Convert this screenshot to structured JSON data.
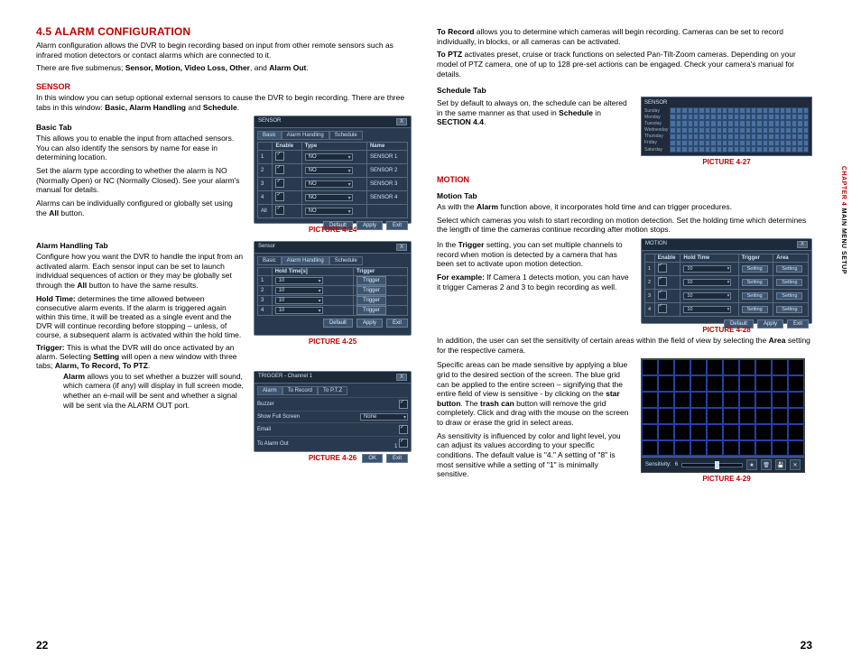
{
  "left": {
    "heading": "4.5 ALARM CONFIGURATION",
    "intro1": "Alarm configuration allows the DVR to begin recording based on input from other remote sensors such as infrared motion detectors or contact alarms which are connected to it.",
    "intro2_pre": "There are five submenus; ",
    "intro2_list": "Sensor, Motion, Video Loss, Other",
    "intro2_post": ", and ",
    "intro2_last": "Alarm Out",
    "sensor": {
      "title": "SENSOR",
      "p1_pre": "In this window you can setup optional external sensors to cause the DVR to begin recording. There are three tabs in this window: ",
      "p1_list": "Basic, Alarm Handling",
      "p1_post": " and ",
      "p1_last": "Schedule",
      "basic": {
        "title": "Basic Tab",
        "p1": "This allows you to enable the input from attached sensors. You can also identify the sensors by name for ease in determining location.",
        "p2": "Set the alarm type according to whether the alarm is NO (Normally Open) or NC (Normally Closed). See your alarm's manual for details.",
        "p3_pre": "Alarms can be individually configured or globally set using the ",
        "p3_b": "All",
        "p3_post": " button."
      },
      "handling": {
        "title": "Alarm Handling Tab",
        "p1_pre": "Configure how you want the DVR to handle the input from an activated alarm. Each sensor input can be set to launch individual sequences of action or they may be globally set through the ",
        "p1_b": "All",
        "p1_post": " button to have the same results.",
        "hold_term": "Hold Time:",
        "hold_desc": " determines the time allowed between consecutive alarm events. If the alarm is triggered again within this time, it will be treated as a single event and the DVR will continue recording before stopping – unless, of course, a subsequent alarm is activated within the hold time.",
        "trig_term": "Trigger:",
        "trig_desc_pre": " This is what the DVR will do once activated by an alarm. Selecting ",
        "trig_set": "Setting",
        "trig_desc_mid": " will open a new window with three tabs; ",
        "trig_tabs": "Alarm, To Record, To PTZ",
        "alarm_b": "Alarm",
        "alarm_desc": " allows you to set whether a buzzer will sound, which camera (if any) will display in full screen mode, whether an e-mail will be sent and whether a signal will be sent via the ALARM OUT port."
      }
    },
    "fig24": {
      "title": "SENSOR",
      "tab1": "Basic",
      "tab2": "Alarm Handling",
      "tab3": "Schedule",
      "h1": "Enable",
      "h2": "Type",
      "h3": "Name",
      "no": "NO",
      "s1": "SENSOR 1",
      "s2": "SENSOR 2",
      "s3": "SENSOR 3",
      "s4": "SENSOR 4",
      "all": "All",
      "b1": "Default",
      "b2": "Apply",
      "b3": "Exit",
      "cap": "PICTURE 4-24"
    },
    "fig25": {
      "title": "Sensor",
      "tab1": "Basic",
      "tab2": "Alarm Handling",
      "tab3": "Schedule",
      "h1": "Hold Time[s]",
      "h2": "Trigger",
      "v": "10",
      "t": "Trigger",
      "b1": "Default",
      "b2": "Apply",
      "b3": "Exit",
      "cap": "PICTURE 4-25"
    },
    "fig26": {
      "title": "TRIGGER - Channel 1",
      "tab1": "Alarm",
      "tab2": "To Record",
      "tab3": "To P.T.Z",
      "r1": "Buzzer",
      "r2": "Show Full Screen",
      "r2v": "None",
      "r3": "Email",
      "r4": "To Alarm Out",
      "r4v": "1",
      "ok": "OK",
      "exit": "Exit",
      "cap": "PICTURE 4-26"
    },
    "pagenum": "22"
  },
  "right": {
    "p_rec_b": "To Record",
    "p_rec": " allows you to determine which cameras will begin recording. Cameras can be set to record individually, in blocks, or all cameras can be activated.",
    "p_ptz_b": "To PTZ",
    "p_ptz": " activates preset, cruise or track functions on selected Pan-Tilt-Zoom cameras. Depending on your model of PTZ camera, one of up to 128 pre-set actions can be engaged. Check your camera's manual for details.",
    "sched": {
      "title": "Schedule Tab",
      "p_pre": "Set by default to always on, the schedule can be altered in the same manner as that used in ",
      "p_b": "Schedule",
      "p_mid": " in ",
      "p_sec": "SECTION 4.4",
      "days": [
        "Sunday",
        "Monday",
        "Tuesday",
        "Wednesday",
        "Thursday",
        "Friday",
        "Saturday"
      ],
      "fig_title": "SENSOR",
      "cap": "PICTURE 4-27"
    },
    "motion": {
      "title": "MOTION",
      "tab": "Motion Tab",
      "p1_pre": "As with the ",
      "p1_b": "Alarm",
      "p1_post": " function above, it incorporates hold time and can trigger procedures.",
      "p2": "Select which cameras you wish to start recording on motion detection. Set the holding time which determines the length of time the cameras continue recording after motion stops.",
      "p3_pre": "In the ",
      "p3_b": "Trigger",
      "p3_post": " setting, you can set multiple channels to record when motion is detected by a camera that has been set to activate upon motion detection.",
      "p4_pre": "For example:",
      "p4": " If Camera 1 detects motion, you can have it trigger Cameras 2 and 3 to begin recording as well.",
      "p5_pre": "In addition, the user can set the sensitivity of certain areas within the field of view by selecting the ",
      "p5_b": "Area",
      "p5_post": " setting for the respective camera.",
      "p6_pre": "Specific areas can be made sensitive by applying a blue grid to the desired section of the screen. The blue grid can be applied to the entire screen – signifying that the entire field of view is sensitive - by clicking on the ",
      "p6_b1": "star button",
      "p6_mid": ". The ",
      "p6_b2": "trash can",
      "p6_post": " button will remove the grid completely. Click and drag with the mouse on the screen to draw or erase the grid in select areas.",
      "p7": " As sensitivity is influenced by color and light level, you can adjust its values according to your specific conditions. The default value is \"4.\" A setting of \"8\" is most sensitive while a setting of \"1\" is minimally sensitive.",
      "fig28": {
        "title": "MOTION",
        "h_en": "Enable",
        "h_ht": "Hold Time",
        "h_tr": "Trigger",
        "h_ar": "Area",
        "ht": "10",
        "set": "Setting",
        "b1": "Default",
        "b2": "Apply",
        "b3": "Exit",
        "cap": "PICTURE 4-28"
      },
      "fig29": {
        "sens_label": "Sensitivity:",
        "sens_val": "6",
        "cap": "PICTURE 4-29"
      }
    },
    "side_ch": "CHAPTER 4",
    "side_t": " MAIN MENU SETUP",
    "pagenum": "23"
  }
}
